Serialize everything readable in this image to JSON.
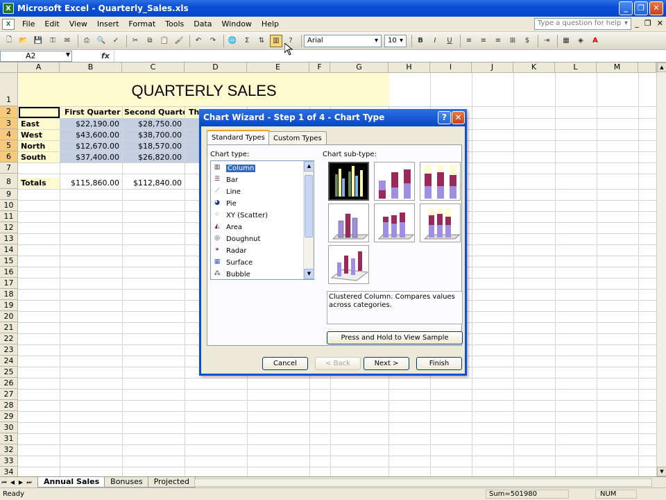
{
  "window": {
    "title": "Microsoft Excel - Quarterly_Sales.xls",
    "app_icon": "excel-icon"
  },
  "menu": {
    "items": [
      "File",
      "Edit",
      "View",
      "Insert",
      "Format",
      "Tools",
      "Data",
      "Window",
      "Help"
    ],
    "question_placeholder": "Type a question for help"
  },
  "toolbar": {
    "font": "Arial",
    "size": "10",
    "bold": "B",
    "italic": "I",
    "underline": "U",
    "sigma": "Σ",
    "chart_wizard_icon": "chart-wizard-icon"
  },
  "formula": {
    "namebox": "A2",
    "fx": "fx",
    "content": ""
  },
  "columns": [
    "A",
    "B",
    "C",
    "D",
    "E",
    "F",
    "G",
    "H",
    "I",
    "J",
    "K",
    "L",
    "M"
  ],
  "rows": [
    "1",
    "2",
    "3",
    "4",
    "5",
    "6",
    "7",
    "8",
    "9",
    "10",
    "11",
    "12",
    "13",
    "14",
    "15",
    "16",
    "17",
    "18",
    "19",
    "20",
    "21",
    "22",
    "23",
    "24",
    "25",
    "26",
    "27",
    "28",
    "29",
    "30",
    "31",
    "32",
    "33",
    "34"
  ],
  "sheet": {
    "title": "QUARTERLY SALES",
    "headers": [
      "First Quarter",
      "Second Quarter",
      "Th"
    ],
    "regions": [
      {
        "name": "East",
        "q1": "$22,190.00",
        "q2": "$28,750.00"
      },
      {
        "name": "West",
        "q1": "$43,600.00",
        "q2": "$38,700.00"
      },
      {
        "name": "North",
        "q1": "$12,670.00",
        "q2": "$18,570.00"
      },
      {
        "name": "South",
        "q1": "$37,400.00",
        "q2": "$26,820.00"
      }
    ],
    "totals": {
      "label": "Totals",
      "q1": "$115,860.00",
      "q2": "$112,840.00"
    }
  },
  "sheet_tabs": [
    "Annual Sales",
    "Bonuses",
    "Projected"
  ],
  "status": {
    "ready": "Ready",
    "sum": "Sum=501980",
    "num": "NUM"
  },
  "dialog": {
    "title": "Chart Wizard - Step 1 of 4 - Chart Type",
    "tabs": [
      "Standard Types",
      "Custom Types"
    ],
    "chart_type_label": "Chart type:",
    "chart_subtype_label": "Chart sub-type:",
    "chart_types": [
      {
        "label": "Column",
        "icon": "column-chart-icon",
        "glyph": "▥"
      },
      {
        "label": "Bar",
        "icon": "bar-chart-icon",
        "glyph": "☰"
      },
      {
        "label": "Line",
        "icon": "line-chart-icon",
        "glyph": "⟋"
      },
      {
        "label": "Pie",
        "icon": "pie-chart-icon",
        "glyph": "◕"
      },
      {
        "label": "XY (Scatter)",
        "icon": "scatter-chart-icon",
        "glyph": "⁘"
      },
      {
        "label": "Area",
        "icon": "area-chart-icon",
        "glyph": "◭"
      },
      {
        "label": "Doughnut",
        "icon": "doughnut-chart-icon",
        "glyph": "◎"
      },
      {
        "label": "Radar",
        "icon": "radar-chart-icon",
        "glyph": "✶"
      },
      {
        "label": "Surface",
        "icon": "surface-chart-icon",
        "glyph": "▦"
      },
      {
        "label": "Bubble",
        "icon": "bubble-chart-icon",
        "glyph": "⁂"
      }
    ],
    "selected_type": "Column",
    "description": "Clustered Column. Compares values across categories.",
    "preview_button": "Press and Hold to View Sample",
    "buttons": {
      "cancel": "Cancel",
      "back": "< Back",
      "next": "Next >",
      "finish": "Finish"
    },
    "help_glyph": "?",
    "close_glyph": "✕"
  }
}
